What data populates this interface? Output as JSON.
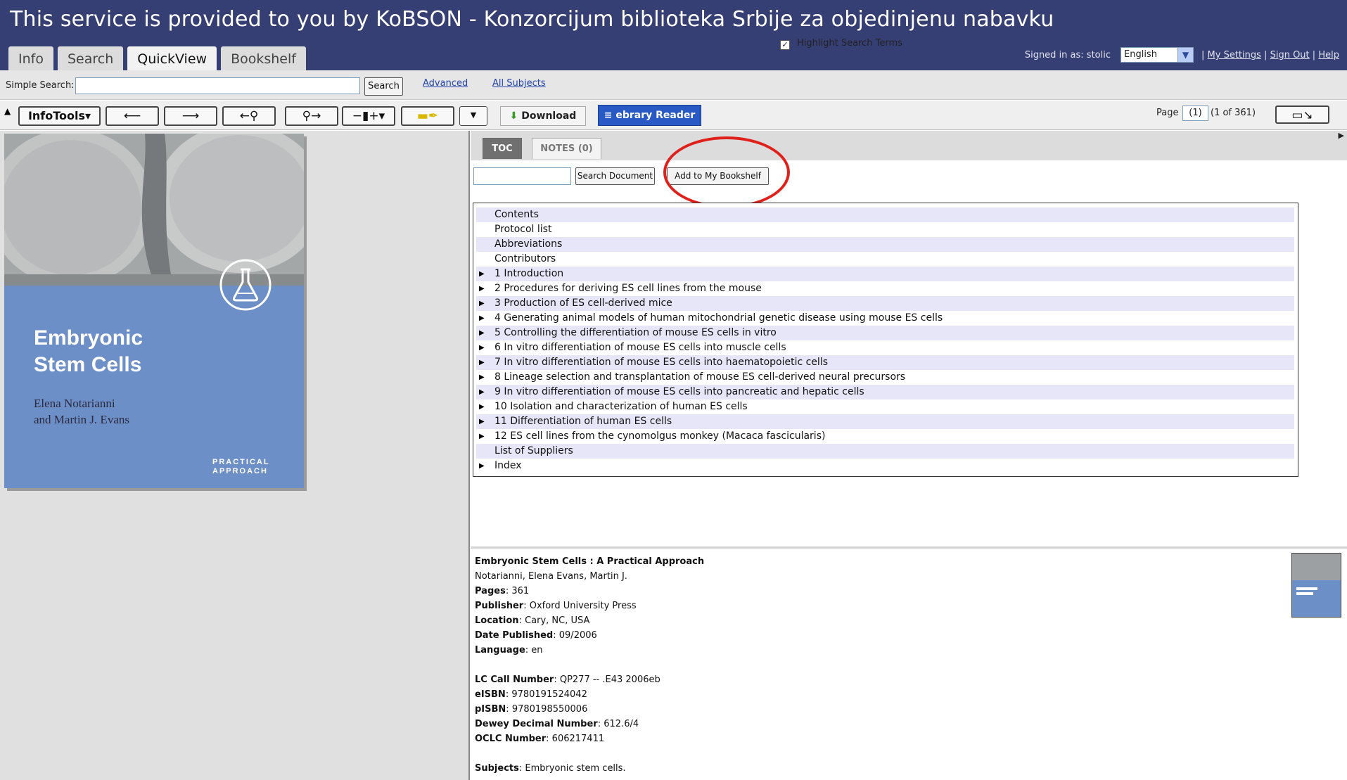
{
  "banner": {
    "title": "This service is provided to you by KoBSON - Konzorcijum biblioteka Srbije za objedinjenu nabavku",
    "tabs": [
      "Info",
      "Search",
      "QuickView",
      "Bookshelf"
    ],
    "active_tab": "QuickView",
    "signed_in": "Signed in as: stolic",
    "language": "English",
    "links": {
      "sep": "|",
      "settings": "My Settings",
      "signout": "Sign Out",
      "help": "Help"
    }
  },
  "search": {
    "label": "Simple Search:",
    "value": "",
    "button": "Search",
    "advanced": "Advanced",
    "all_subjects": "All Subjects"
  },
  "toolbar": {
    "infotools": "InfoTools",
    "download": "Download",
    "ebrary": "ebrary Reader",
    "page_label": "Page",
    "page_value": "(1)",
    "page_count": "(1 of 361)"
  },
  "cover": {
    "title_line1": "Embryonic",
    "title_line2": "Stem Cells",
    "author_line1": "Elena Notarianni",
    "author_line2": "and Martin J. Evans",
    "series_line1": "PRACTICAL",
    "series_line2": "APPROACH"
  },
  "panel": {
    "tab_toc": "TOC",
    "tab_notes": "NOTES (0)",
    "search_doc_btn": "Search Document",
    "add_bookshelf_btn": "Add to My Bookshelf",
    "highlight_label": "Highlight Search Terms",
    "highlight_checked": true
  },
  "toc": [
    {
      "label": "Contents",
      "expandable": false
    },
    {
      "label": "Protocol list",
      "expandable": false
    },
    {
      "label": "Abbreviations",
      "expandable": false
    },
    {
      "label": "Contributors",
      "expandable": false
    },
    {
      "label": "1 Introduction",
      "expandable": true
    },
    {
      "label": "2 Procedures for deriving ES cell lines from the mouse",
      "expandable": true
    },
    {
      "label": "3 Production of ES cell-derived mice",
      "expandable": true
    },
    {
      "label": "4 Generating animal models of human mitochondrial genetic disease using mouse ES cells",
      "expandable": true
    },
    {
      "label": "5 Controlling the differentiation of mouse ES cells in vitro",
      "expandable": true
    },
    {
      "label": "6 In vitro differentiation of mouse ES cells into muscle cells",
      "expandable": true
    },
    {
      "label": "7 In vitro differentiation of mouse ES cells into haematopoietic cells",
      "expandable": true
    },
    {
      "label": "8 Lineage selection and transplantation of mouse ES cell-derived neural precursors",
      "expandable": true
    },
    {
      "label": "9 In vitro differentiation of mouse ES cells into pancreatic and hepatic cells",
      "expandable": true
    },
    {
      "label": "10 Isolation and characterization of human ES cells",
      "expandable": true
    },
    {
      "label": "11 Differentiation of human ES cells",
      "expandable": true
    },
    {
      "label": "12 ES cell lines from the cynomolgus monkey (Macaca fascicularis)",
      "expandable": true
    },
    {
      "label": "List of Suppliers",
      "expandable": false
    },
    {
      "label": "Index",
      "expandable": true
    }
  ],
  "book": {
    "title": "Embryonic Stem Cells : A Practical Approach",
    "authors": "Notarianni, Elena Evans, Martin J.",
    "fields": [
      {
        "label": "Pages",
        "value": "361"
      },
      {
        "label": "Publisher",
        "value": "Oxford University Press"
      },
      {
        "label": "Location",
        "value": "Cary, NC, USA"
      },
      {
        "label": "Date Published",
        "value": "09/2006"
      },
      {
        "label": "Language",
        "value": "en"
      }
    ],
    "ids": [
      {
        "label": "LC Call Number",
        "value": "QP277 -- .E43 2006eb"
      },
      {
        "label": "eISBN",
        "value": "9780191524042"
      },
      {
        "label": "pISBN",
        "value": "9780198550006"
      },
      {
        "label": "Dewey Decimal Number",
        "value": "612.6/4"
      },
      {
        "label": "OCLC Number",
        "value": "606217411"
      }
    ],
    "subjects_label": "Subjects",
    "subjects": "Embryonic stem cells."
  }
}
